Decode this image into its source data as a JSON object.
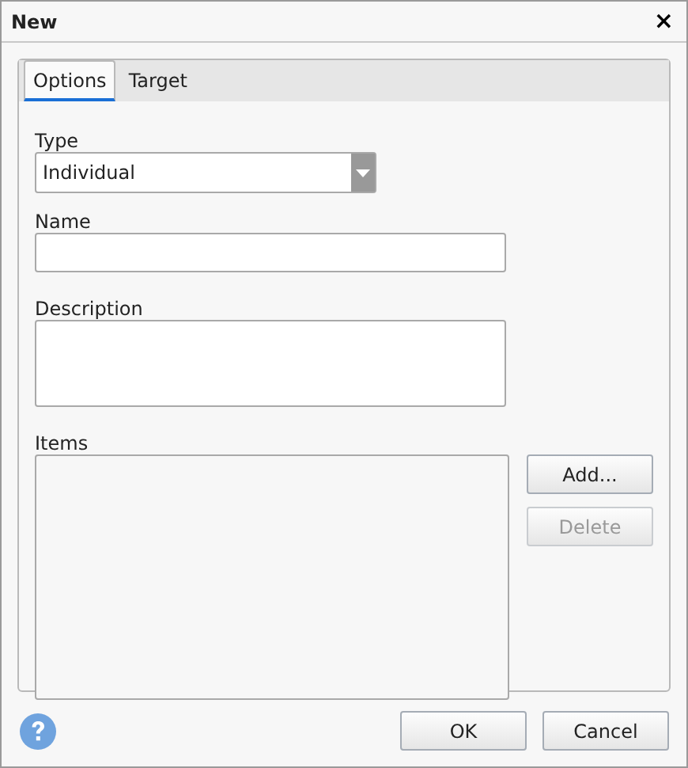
{
  "window": {
    "title": "New",
    "close": "×"
  },
  "tabs": [
    {
      "label": "Options",
      "selected": true
    },
    {
      "label": "Target",
      "selected": false
    }
  ],
  "type_field": {
    "label": "Type",
    "value": "Individual"
  },
  "name_field": {
    "label": "Name"
  },
  "description_field": {
    "label": "Description"
  },
  "items": {
    "label": "Items",
    "buttons": [
      {
        "label": "Add...",
        "disabled": false
      },
      {
        "label": "Delete",
        "disabled": true
      }
    ]
  },
  "footer_buttons": [
    "OK",
    "Cancel"
  ]
}
